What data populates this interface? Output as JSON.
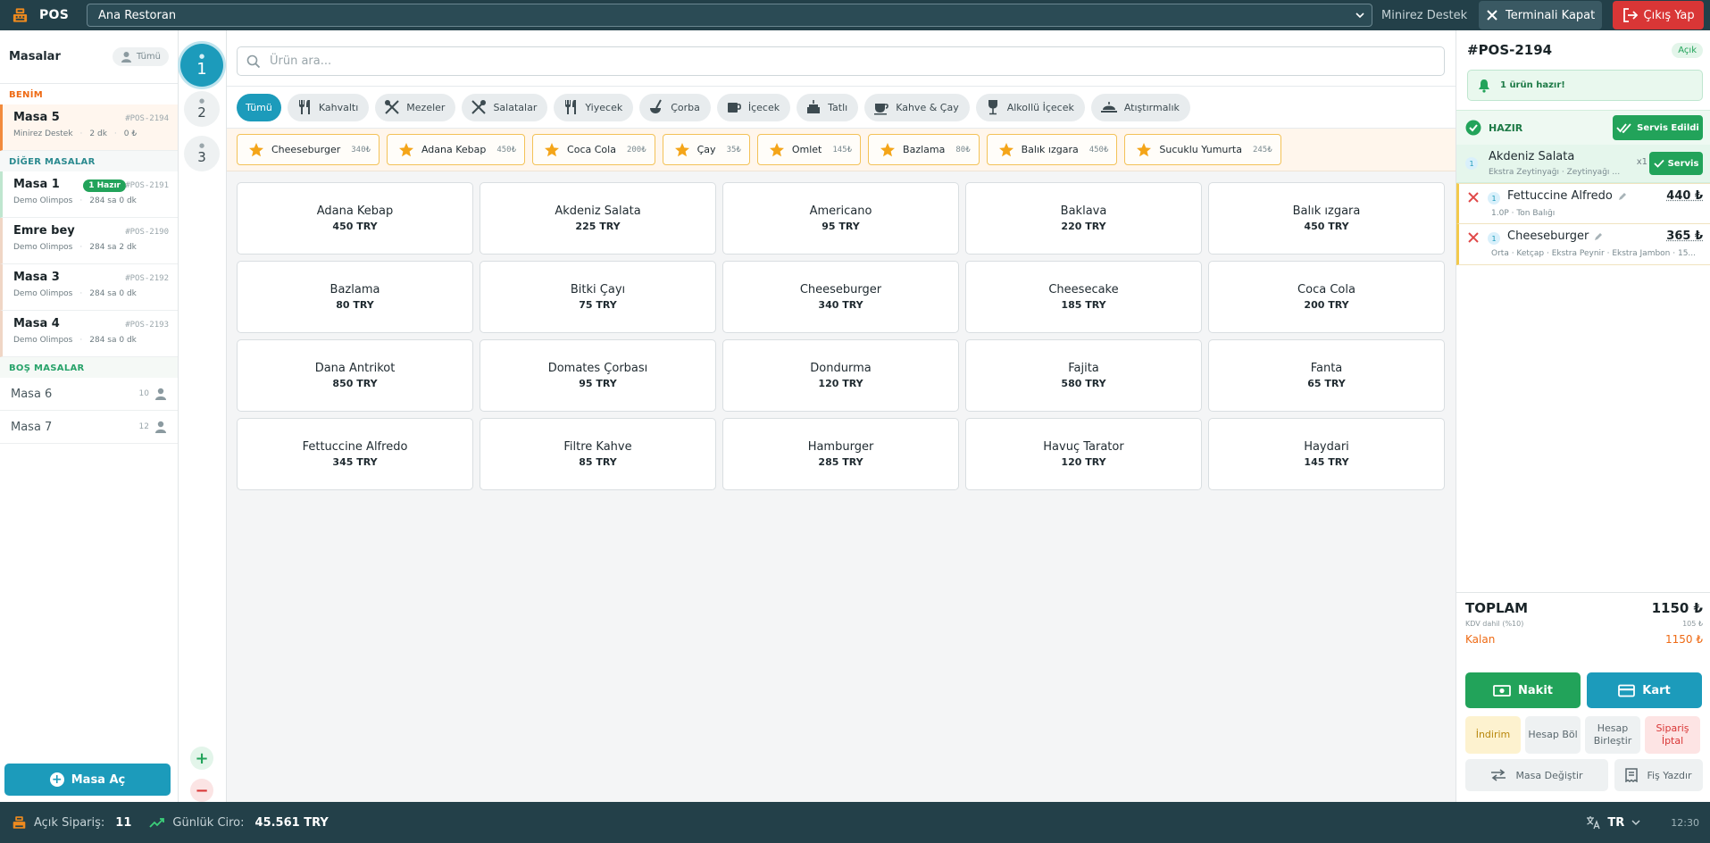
{
  "topbar": {
    "app_title": "POS",
    "restaurant": "Ana Restoran",
    "user": "Minirez Destek",
    "close_terminal": "Terminali Kapat",
    "logout": "Çıkış Yap"
  },
  "tables": {
    "title": "Masalar",
    "filter_label": "Tümü",
    "section_mine": "BENİM",
    "section_other": "DİĞER MASALAR",
    "section_empty": "BOŞ MASALAR",
    "mine": [
      {
        "name": "Masa 5",
        "code": "#POS-2194",
        "user": "Minirez Destek",
        "time": "2 dk",
        "amount": "0 ₺"
      }
    ],
    "other": [
      {
        "name": "Masa 1",
        "code": "#POS-2191",
        "user": "Demo Olimpos",
        "time": "284 sa 0 dk",
        "badge": "1 Hazır"
      },
      {
        "name": "Emre bey",
        "code": "#POS-2190",
        "user": "Demo Olimpos",
        "time": "284 sa 2 dk",
        "badge": ""
      },
      {
        "name": "Masa 3",
        "code": "#POS-2192",
        "user": "Demo Olimpos",
        "time": "284 sa 0 dk",
        "badge": ""
      },
      {
        "name": "Masa 4",
        "code": "#POS-2193",
        "user": "Demo Olimpos",
        "time": "284 sa 0 dk",
        "badge": ""
      }
    ],
    "empty": [
      {
        "name": "Masa 6",
        "capacity": "10"
      },
      {
        "name": "Masa 7",
        "capacity": "12"
      }
    ],
    "open_table": "Masa Aç"
  },
  "guests": {
    "items": [
      "1",
      "2",
      "3"
    ],
    "active": "1"
  },
  "search": {
    "placeholder": "Ürün ara..."
  },
  "categories": [
    {
      "label": "Tümü",
      "icon": "none"
    },
    {
      "label": "Kahvaltı",
      "icon": "utensils-icon"
    },
    {
      "label": "Mezeler",
      "icon": "utensils-crossed-icon"
    },
    {
      "label": "Salatalar",
      "icon": "utensils-crossed-icon"
    },
    {
      "label": "Yiyecek",
      "icon": "utensils-icon"
    },
    {
      "label": "Çorba",
      "icon": "soup-ladle-icon"
    },
    {
      "label": "İçecek",
      "icon": "mug-icon"
    },
    {
      "label": "Tatlı",
      "icon": "cake-icon"
    },
    {
      "label": "Kahve & Çay",
      "icon": "coffee-cup-icon"
    },
    {
      "label": "Alkollü İçecek",
      "icon": "wine-glass-icon"
    },
    {
      "label": "Atıştırmalık",
      "icon": "food-tray-icon"
    }
  ],
  "favorites": [
    {
      "name": "Cheeseburger",
      "price": "340₺"
    },
    {
      "name": "Adana Kebap",
      "price": "450₺"
    },
    {
      "name": "Coca Cola",
      "price": "200₺"
    },
    {
      "name": "Çay",
      "price": "35₺"
    },
    {
      "name": "Omlet",
      "price": "145₺"
    },
    {
      "name": "Bazlama",
      "price": "80₺"
    },
    {
      "name": "Balık ızgara",
      "price": "450₺"
    },
    {
      "name": "Sucuklu Yumurta",
      "price": "245₺"
    }
  ],
  "products": [
    {
      "name": "Adana Kebap",
      "price": "450 TRY"
    },
    {
      "name": "Akdeniz Salata",
      "price": "225 TRY"
    },
    {
      "name": "Americano",
      "price": "95 TRY"
    },
    {
      "name": "Baklava",
      "price": "220 TRY"
    },
    {
      "name": "Balık ızgara",
      "price": "450 TRY"
    },
    {
      "name": "Bazlama",
      "price": "80 TRY"
    },
    {
      "name": "Bitki Çayı",
      "price": "75 TRY"
    },
    {
      "name": "Cheeseburger",
      "price": "340 TRY"
    },
    {
      "name": "Cheesecake",
      "price": "185 TRY"
    },
    {
      "name": "Coca Cola",
      "price": "200 TRY"
    },
    {
      "name": "Dana Antrikot",
      "price": "850 TRY"
    },
    {
      "name": "Domates Çorbası",
      "price": "95 TRY"
    },
    {
      "name": "Dondurma",
      "price": "120 TRY"
    },
    {
      "name": "Fajita",
      "price": "580 TRY"
    },
    {
      "name": "Fanta",
      "price": "65 TRY"
    },
    {
      "name": "Fettuccine Alfredo",
      "price": "345 TRY"
    },
    {
      "name": "Filtre Kahve",
      "price": "85 TRY"
    },
    {
      "name": "Hamburger",
      "price": "285 TRY"
    },
    {
      "name": "Havuç Tarator",
      "price": "120 TRY"
    },
    {
      "name": "Haydari",
      "price": "145 TRY"
    }
  ],
  "order": {
    "id": "#POS-2194",
    "status": "Açık",
    "notice": "1 ürün hazır!",
    "ready_label": "HAZIR",
    "served_all": "Servis Edildi",
    "ready_items": [
      {
        "qty": "1",
        "name": "Akdeniz Salata",
        "options": "Ekstra Zeytinyağı · Zeytinyağı ; Li...",
        "mult": "x1",
        "serve": "Servis"
      }
    ],
    "items": [
      {
        "qty": "1",
        "name": "Fettuccine Alfredo",
        "options": "1.0P · Ton Balığı",
        "price": "440 ₺"
      },
      {
        "qty": "1",
        "name": "Cheeseburger",
        "options": "Orta · Ketçap · Ekstra Peynir · Ekstra Jambon · 15...",
        "price": "365 ₺"
      }
    ],
    "total_label": "TOPLAM",
    "total": "1150 ₺",
    "vat_label": "KDV dahil (%10)",
    "vat": "105 ₺",
    "remaining_label": "Kalan",
    "remaining": "1150 ₺",
    "cash": "Nakit",
    "card": "Kart",
    "discount": "İndirim",
    "split": "Hesap Böl",
    "merge": "Hesap Birleştir",
    "cancel": "Sipariş İptal",
    "change_table": "Masa Değiştir",
    "print_receipt": "Fiş Yazdır"
  },
  "footer": {
    "open_orders_label": "Açık Sipariş:",
    "open_orders": "11",
    "daily_label": "Günlük Ciro:",
    "daily": "45.561 TRY",
    "lang": "TR",
    "time": "12:30"
  },
  "colors": {
    "brand": "#1c9bbb",
    "dark": "#234049",
    "success": "#22a35a",
    "danger": "#d93636",
    "accent": "#ee6a14"
  }
}
